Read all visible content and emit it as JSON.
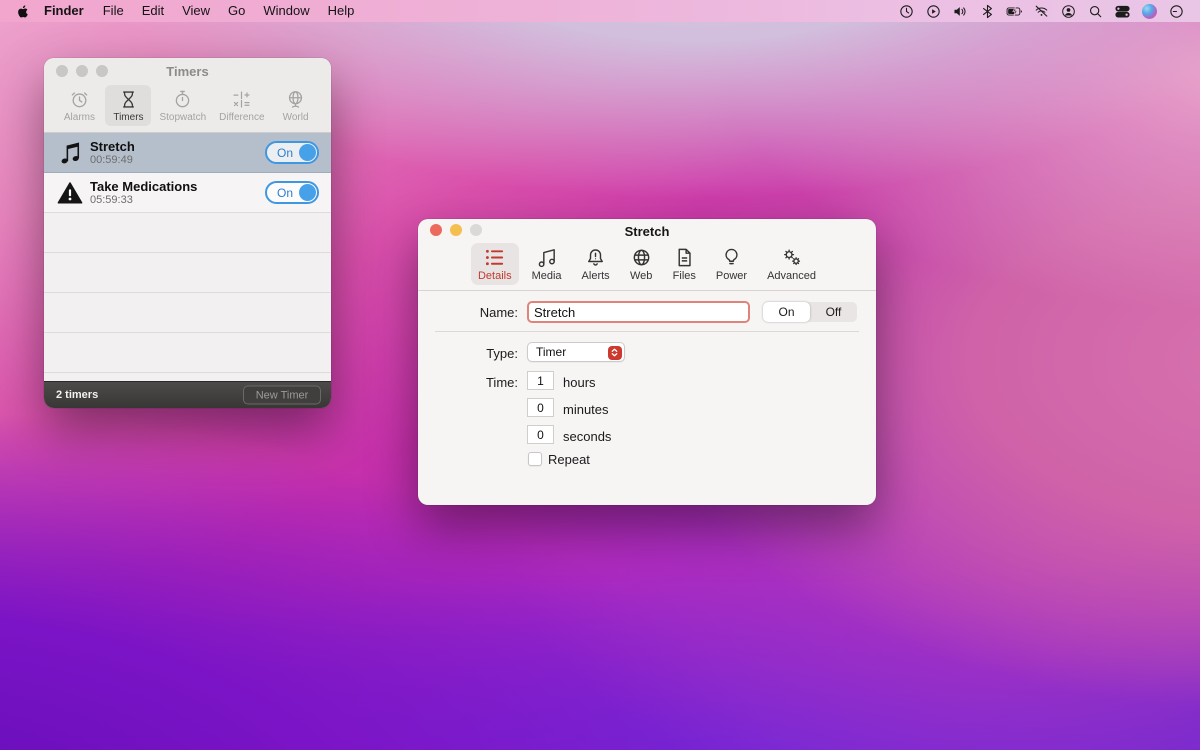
{
  "menu_bar": {
    "app_name": "Finder",
    "menus": [
      "File",
      "Edit",
      "View",
      "Go",
      "Window",
      "Help"
    ],
    "status_icons": [
      "clock",
      "play-circle",
      "volume",
      "bluetooth",
      "battery-charging",
      "wifi-off",
      "user",
      "search",
      "control-center",
      "siri",
      "clock-outline"
    ]
  },
  "timers_window": {
    "title": "Timers",
    "tabs": [
      {
        "label": "Alarms",
        "icon": "alarm-clock",
        "selected": false
      },
      {
        "label": "Timers",
        "icon": "hourglass",
        "selected": true
      },
      {
        "label": "Stopwatch",
        "icon": "stopwatch",
        "selected": false
      },
      {
        "label": "Difference",
        "icon": "difference-math",
        "selected": false
      },
      {
        "label": "World",
        "icon": "world-globe",
        "selected": false
      }
    ],
    "rows": [
      {
        "icon": "music-note",
        "name": "Stretch",
        "time": "00:59:49",
        "toggle_label": "On",
        "toggle_state": "on",
        "selected": true
      },
      {
        "icon": "warning-triangle",
        "name": "Take Medications",
        "time": "05:59:33",
        "toggle_label": "On",
        "toggle_state": "on",
        "selected": false
      }
    ],
    "footer": {
      "count_label": "2 timers",
      "new_timer_label": "New Timer"
    }
  },
  "detail_window": {
    "title": "Stretch",
    "tabs": [
      {
        "label": "Details",
        "icon": "list-details",
        "selected": true
      },
      {
        "label": "Media",
        "icon": "music-note",
        "selected": false
      },
      {
        "label": "Alerts",
        "icon": "bell-alert",
        "selected": false
      },
      {
        "label": "Web",
        "icon": "globe-web",
        "selected": false
      },
      {
        "label": "Files",
        "icon": "document",
        "selected": false
      },
      {
        "label": "Power",
        "icon": "light-bulb",
        "selected": false
      },
      {
        "label": "Advanced",
        "icon": "gears",
        "selected": false
      }
    ],
    "form": {
      "name_label": "Name:",
      "name_value": "Stretch",
      "state_on": "On",
      "state_off": "Off",
      "type_label": "Type:",
      "type_value": "Timer",
      "time_label": "Time:",
      "hours_value": "1",
      "hours_unit": "hours",
      "minutes_value": "0",
      "minutes_unit": "minutes",
      "seconds_value": "0",
      "seconds_unit": "seconds",
      "repeat_label": "Repeat"
    }
  },
  "colors": {
    "accent_red": "#c13a31",
    "toggle_blue": "#419fe8",
    "traffic_red": "#ec6a5d",
    "traffic_yellow": "#f5bf4f",
    "selected_row": "#b5bfcc",
    "menubar_pink": "#eeb2d8"
  }
}
